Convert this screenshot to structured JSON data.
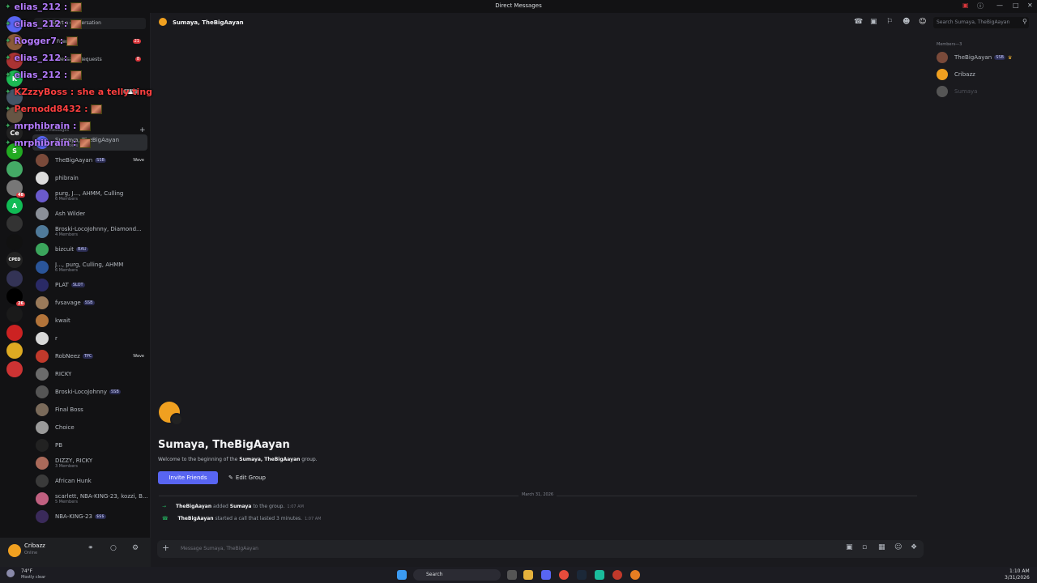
{
  "window": {
    "title": "Direct Messages"
  },
  "sidebar": {
    "start_conversation": "Start a conversation",
    "friends_label": "Friends",
    "friends_badge": "21",
    "message_requests_label": "Message Requests",
    "message_requests_badge": "8",
    "direct_messages_label": "Direct Messages",
    "add_dm": "+",
    "dms": [
      {
        "name": "Sumaya, TheBigAayan",
        "sub": "3 Members",
        "tag": "",
        "wave": "",
        "color": "#5865f2"
      },
      {
        "name": "TheBigAayan",
        "sub": "",
        "tag": "SSB",
        "wave": "Wave",
        "color": "#7a4a3a"
      },
      {
        "name": "phibrain",
        "sub": "",
        "tag": "",
        "wave": "",
        "color": "#dcdcdc"
      },
      {
        "name": "purg, J..., AHMM, Culling",
        "sub": "6 Members",
        "tag": "",
        "wave": "",
        "color": "#6a5acd"
      },
      {
        "name": "Ash Wilder",
        "sub": "",
        "tag": "",
        "wave": "",
        "color": "#8a8f98"
      },
      {
        "name": "Broski-LocoJohnny, Diamond...",
        "sub": "4 Members",
        "tag": "",
        "wave": "",
        "color": "#4f7a9a"
      },
      {
        "name": "bizcuit",
        "sub": "",
        "tag": "BAU",
        "wave": "",
        "color": "#3ba55c"
      },
      {
        "name": "J..., purg, Culling, AHMM",
        "sub": "6 Members",
        "tag": "",
        "wave": "",
        "color": "#2a5599"
      },
      {
        "name": "PLAT",
        "sub": "",
        "tag": "SLOT",
        "wave": "",
        "color": "#2a2a66"
      },
      {
        "name": "fvsavage",
        "sub": "",
        "tag": "SSB",
        "wave": "",
        "color": "#9a7a5a"
      },
      {
        "name": "kwait",
        "sub": "",
        "tag": "",
        "wave": "",
        "color": "#b3743a"
      },
      {
        "name": "r",
        "sub": "",
        "tag": "",
        "wave": "",
        "color": "#d8d8d8"
      },
      {
        "name": "RobNeez",
        "sub": "",
        "tag": "TPC",
        "wave": "Wave",
        "color": "#c0392b"
      },
      {
        "name": "RICKY",
        "sub": "",
        "tag": "",
        "wave": "",
        "color": "#6b6b6b"
      },
      {
        "name": "Broski-LocoJohnny",
        "sub": "",
        "tag": "SSB",
        "wave": "",
        "color": "#555"
      },
      {
        "name": "Final Boss",
        "sub": "",
        "tag": "",
        "wave": "",
        "color": "#7a6a5a"
      },
      {
        "name": "Choice",
        "sub": "",
        "tag": "",
        "wave": "",
        "color": "#9a9a9a"
      },
      {
        "name": "PB",
        "sub": "",
        "tag": "",
        "wave": "",
        "color": "#222"
      },
      {
        "name": "DIZZY, RICKY",
        "sub": "3 Members",
        "tag": "",
        "wave": "",
        "color": "#aa6a5a"
      },
      {
        "name": "African Hunk",
        "sub": "",
        "tag": "",
        "wave": "",
        "color": "#3a3a3a"
      },
      {
        "name": "scarlett, NBA-KING-23, kozzi, B...",
        "sub": "5 Members",
        "tag": "",
        "wave": "",
        "color": "#c06080"
      },
      {
        "name": "NBA-KING-23",
        "sub": "",
        "tag": "$$$",
        "wave": "",
        "color": "#3a2a5a"
      }
    ]
  },
  "guilds": [
    {
      "label": "",
      "color": "#5865f2",
      "badge": ""
    },
    {
      "label": "",
      "color": "#8a5a3a",
      "badge": ""
    },
    {
      "label": "",
      "color": "#a33",
      "badge": ""
    },
    {
      "label": "K",
      "color": "#1db954",
      "badge": ""
    },
    {
      "label": "",
      "color": "#456",
      "badge": ""
    },
    {
      "label": "",
      "color": "#654",
      "badge": ""
    },
    {
      "label": "Ce",
      "color": "#222",
      "badge": ""
    },
    {
      "label": "S",
      "color": "#2a2",
      "badge": ""
    },
    {
      "label": "",
      "color": "#4a6",
      "badge": ""
    },
    {
      "label": "",
      "color": "#777",
      "badge": "48"
    },
    {
      "label": "A",
      "color": "#1b5",
      "badge": ""
    },
    {
      "label": "",
      "color": "#333",
      "badge": ""
    },
    {
      "label": "",
      "color": "#111",
      "badge": ""
    },
    {
      "label": "CPED",
      "color": "#222",
      "badge": ""
    },
    {
      "label": "",
      "color": "#335",
      "badge": ""
    },
    {
      "label": "",
      "color": "#000",
      "badge": "26"
    },
    {
      "label": "",
      "color": "#1a1a1a",
      "badge": ""
    },
    {
      "label": "",
      "color": "#c22",
      "badge": ""
    },
    {
      "label": "",
      "color": "#da2",
      "badge": ""
    },
    {
      "label": "",
      "color": "#c33",
      "badge": ""
    }
  ],
  "new_badge": "NEW",
  "user": {
    "name": "Cribazz",
    "status": "Online"
  },
  "header": {
    "channel": "Sumaya, TheBigAayan",
    "search_placeholder": "Search Sumaya, TheBigAayan"
  },
  "welcome": {
    "title": "Sumaya, TheBigAayan",
    "prefix": "Welcome to the beginning of the ",
    "group_name": "Sumaya, TheBigAayan",
    "suffix": " group.",
    "invite_button": "Invite Friends",
    "edit_button": "Edit Group"
  },
  "date_divider": "March 31, 2026",
  "events": [
    {
      "actor": "TheBigAayan",
      "verb": " added ",
      "target": "Sumaya",
      "rest": " to the group.",
      "time": "1:07 AM"
    },
    {
      "actor": "TheBigAayan",
      "verb": " started a call that lasted 3 minutes.",
      "target": "",
      "rest": "",
      "time": "1:07 AM"
    }
  ],
  "composer": {
    "placeholder": "Message Sumaya, TheBigAayan"
  },
  "members_panel": {
    "heading": "Members—3",
    "members": [
      {
        "name": "TheBigAayan",
        "tag": "SSB",
        "color": "#7a4a3a"
      },
      {
        "name": "Cribazz",
        "tag": "",
        "color": "#f0a020"
      },
      {
        "name": "Sumaya",
        "tag": "",
        "color": "#555"
      }
    ]
  },
  "chat_overlay": [
    {
      "name": "elias_212 :",
      "color": "#b57cff"
    },
    {
      "name": "elias_212 :",
      "color": "#b57cff"
    },
    {
      "name": "Rogger7 :",
      "color": "#b57cff"
    },
    {
      "name": "elias_212 :",
      "color": "#b57cff"
    },
    {
      "name": "elias_212 :",
      "color": "#b57cff"
    },
    {
      "name": "KZzzyBoss : she a telly ting",
      "color": "#ff4040"
    },
    {
      "name": "Pernodd8432 :",
      "color": "#ff4040"
    },
    {
      "name": "mrphibrain :",
      "color": "#b57cff"
    },
    {
      "name": "mrphibrain :",
      "color": "#b57cff"
    }
  ],
  "taskbar": {
    "weather_temp": "74°F",
    "weather_desc": "Mostly clear",
    "search": "Search",
    "time": "1:10 AM",
    "date": "3/31/2026"
  }
}
